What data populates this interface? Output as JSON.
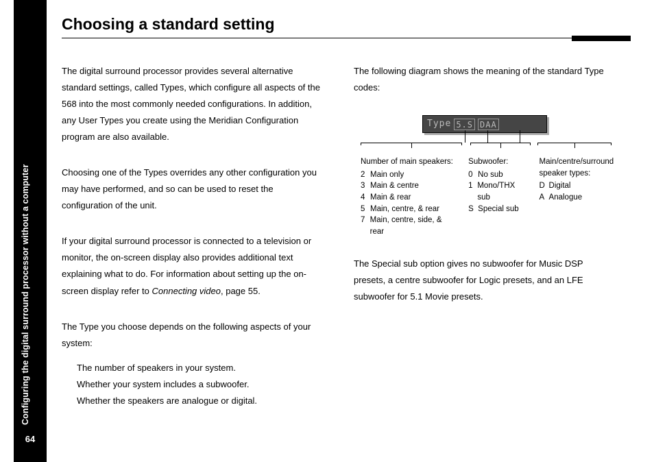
{
  "sidebar": {
    "section_label": "Configuring the digital surround processor without a computer",
    "page_number": "64"
  },
  "page": {
    "title": "Choosing a standard setting"
  },
  "left_col": {
    "p1": "The digital surround processor provides several alternative standard settings, called Types, which configure all aspects of the 568 into the most commonly needed configurations. In addition, any User Types you create using the Meridian Configuration program are also available.",
    "p2": "Choosing one of the Types overrides any other configuration you may have performed, and so can be used to reset the configuration of the unit.",
    "p3_a": "If your digital surround processor is connected to a television or monitor, the on-screen display also provides additional text explaining what to do. For information about setting up the on-screen display refer to ",
    "p3_em": "Connecting video",
    "p3_b": ", page 55.",
    "p4": "The Type you choose depends on the following aspects of your system:",
    "bullets": {
      "b1": "The number of speakers in your system.",
      "b2": "Whether your system includes a subwoofer.",
      "b3": "Whether the speakers are analogue or digital."
    }
  },
  "right_col": {
    "intro": "The following diagram shows the meaning of the standard Type codes:",
    "lcd": {
      "prefix": "Type",
      "box1": "5.S",
      "box2": "DAA"
    },
    "legend1": {
      "heading": "Number of main speakers:",
      "r1k": "2",
      "r1v": "Main only",
      "r2k": "3",
      "r2v": "Main & centre",
      "r3k": "4",
      "r3v": "Main & rear",
      "r4k": "5",
      "r4v": "Main, centre, & rear",
      "r5k": "7",
      "r5v": "Main, centre, side, & rear"
    },
    "legend2": {
      "heading": "Subwoofer:",
      "r1k": "0",
      "r1v": "No sub",
      "r2k": "1",
      "r2v": "Mono/THX sub",
      "r3k": "S",
      "r3v": "Special sub"
    },
    "legend3": {
      "heading": "Main/centre/surround speaker types:",
      "r1k": "D",
      "r1v": "Digital",
      "r2k": "A",
      "r2v": "Analogue"
    },
    "closing": "The Special sub option gives no subwoofer for Music DSP presets, a centre subwoofer for Logic presets, and an LFE subwoofer for 5.1 Movie presets."
  }
}
